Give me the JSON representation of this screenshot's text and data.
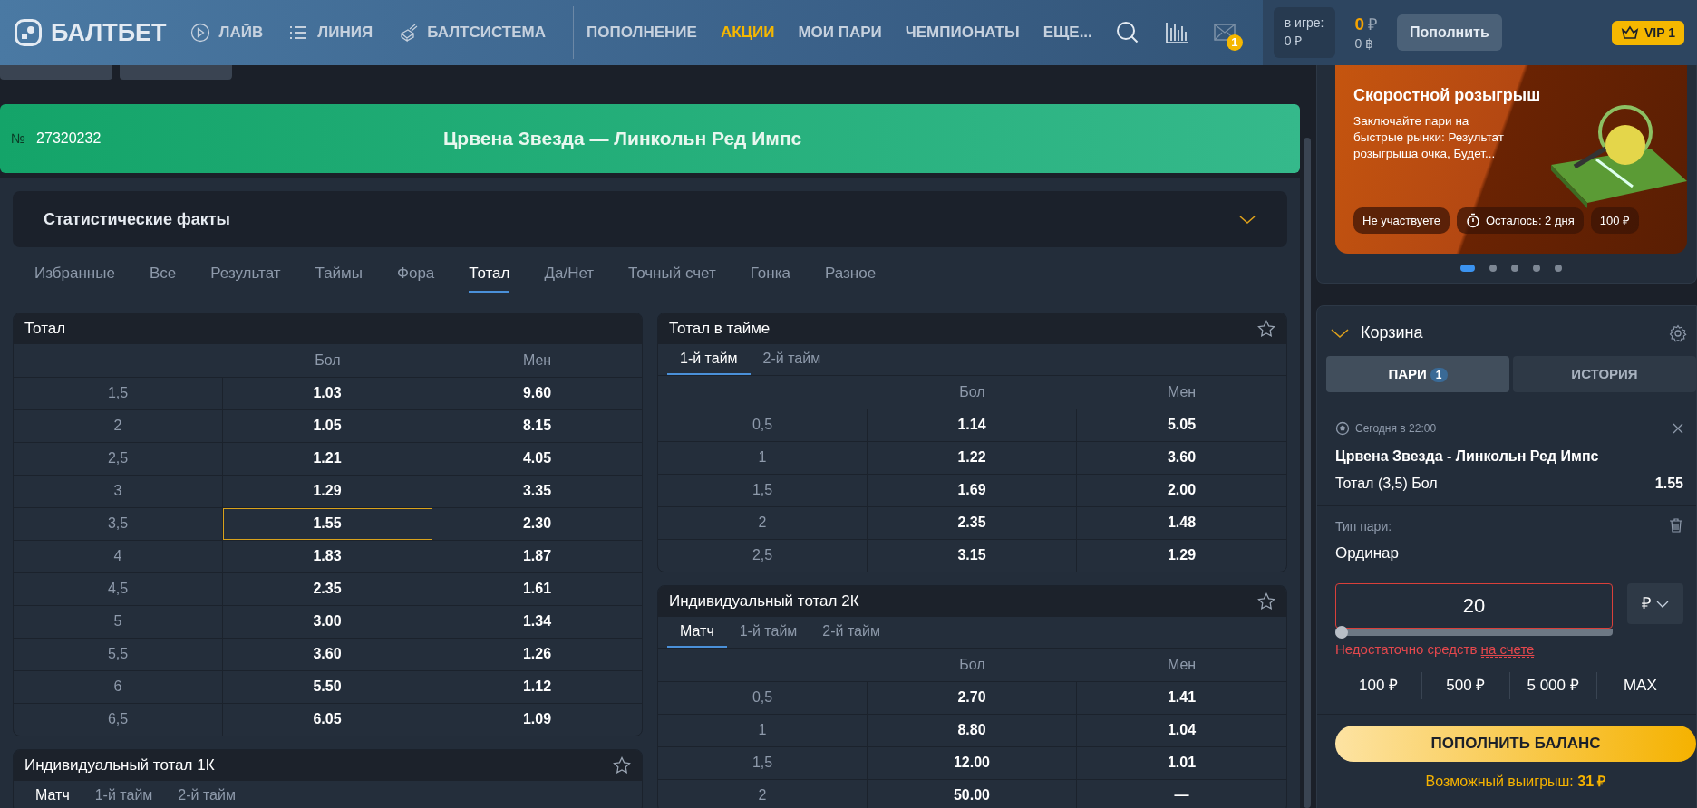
{
  "header": {
    "logo": "БАЛТБЕТ",
    "nav": [
      {
        "label": "ЛАЙВ",
        "kind": "play"
      },
      {
        "label": "ЛИНИЯ",
        "kind": "list"
      },
      {
        "label": "БАЛТСИСТЕМА",
        "kind": "dice"
      }
    ],
    "menu": [
      {
        "label": "ПОПОЛНЕНИЕ",
        "highlighted": false
      },
      {
        "label": "АКЦИИ",
        "highlighted": true
      },
      {
        "label": "МОИ ПАРИ",
        "highlighted": false
      },
      {
        "label": "ЧЕМПИОНАТЫ",
        "highlighted": false
      },
      {
        "label": "ЕЩЕ...",
        "highlighted": false
      }
    ],
    "mail_count": "1",
    "in_game_label": "в игре:",
    "in_game_value": "0 ₽",
    "balance": "0",
    "balance_currency": "₽",
    "bonus": "0 ฿",
    "deposit_button": "Пополнить",
    "vip": "VIP 1"
  },
  "event": {
    "number_sign": "№",
    "number": "27320232",
    "title": "Црвена Звезда — Линкольн Ред Импс"
  },
  "stats": {
    "title": "Статистические факты",
    "expanded": false
  },
  "market_tabs": [
    {
      "label": "Избранные",
      "selected": false
    },
    {
      "label": "Все",
      "selected": false
    },
    {
      "label": "Результат",
      "selected": false
    },
    {
      "label": "Таймы",
      "selected": false
    },
    {
      "label": "Фора",
      "selected": false
    },
    {
      "label": "Тотал",
      "selected": true
    },
    {
      "label": "Да/Нет",
      "selected": false
    },
    {
      "label": "Точный счет",
      "selected": false
    },
    {
      "label": "Гонка",
      "selected": false
    },
    {
      "label": "Разное",
      "selected": false
    }
  ],
  "market_columns": [
    [
      {
        "title": "Тотал",
        "show_star": false,
        "columns": [
          "Бол",
          "Мен"
        ],
        "rows": [
          {
            "line": "1,5",
            "over": "1.03",
            "under": "9.60",
            "over_selected": false,
            "under_selected": false
          },
          {
            "line": "2",
            "over": "1.05",
            "under": "8.15",
            "over_selected": false,
            "under_selected": false
          },
          {
            "line": "2,5",
            "over": "1.21",
            "under": "4.05",
            "over_selected": false,
            "under_selected": false
          },
          {
            "line": "3",
            "over": "1.29",
            "under": "3.35",
            "over_selected": false,
            "under_selected": false
          },
          {
            "line": "3,5",
            "over": "1.55",
            "under": "2.30",
            "over_selected": true,
            "under_selected": false
          },
          {
            "line": "4",
            "over": "1.83",
            "under": "1.87",
            "over_selected": false,
            "under_selected": false
          },
          {
            "line": "4,5",
            "over": "2.35",
            "under": "1.61",
            "over_selected": false,
            "under_selected": false
          },
          {
            "line": "5",
            "over": "3.00",
            "under": "1.34",
            "over_selected": false,
            "under_selected": false
          },
          {
            "line": "5,5",
            "over": "3.60",
            "under": "1.26",
            "over_selected": false,
            "under_selected": false
          },
          {
            "line": "6",
            "over": "5.50",
            "under": "1.12",
            "over_selected": false,
            "under_selected": false
          },
          {
            "line": "6,5",
            "over": "6.05",
            "under": "1.09",
            "over_selected": false,
            "under_selected": false
          }
        ]
      },
      {
        "title": "Индивидуальный тотал 1К",
        "show_star": true,
        "periods": [
          {
            "label": "Матч",
            "selected": true
          },
          {
            "label": "1-й тайм",
            "selected": false
          },
          {
            "label": "2-й тайм",
            "selected": false
          }
        ]
      }
    ],
    [
      {
        "title": "Тотал в тайме",
        "show_star": true,
        "periods": [
          {
            "label": "1-й тайм",
            "selected": true
          },
          {
            "label": "2-й тайм",
            "selected": false
          }
        ],
        "columns": [
          "Бол",
          "Мен"
        ],
        "rows": [
          {
            "line": "0,5",
            "over": "1.14",
            "under": "5.05",
            "over_selected": false,
            "under_selected": false
          },
          {
            "line": "1",
            "over": "1.22",
            "under": "3.60",
            "over_selected": false,
            "under_selected": false
          },
          {
            "line": "1,5",
            "over": "1.69",
            "under": "2.00",
            "over_selected": false,
            "under_selected": false
          },
          {
            "line": "2",
            "over": "2.35",
            "under": "1.48",
            "over_selected": false,
            "under_selected": false
          },
          {
            "line": "2,5",
            "over": "3.15",
            "under": "1.29",
            "over_selected": false,
            "under_selected": false
          }
        ]
      },
      {
        "title": "Индивидуальный тотал 2К",
        "show_star": true,
        "periods": [
          {
            "label": "Матч",
            "selected": true
          },
          {
            "label": "1-й тайм",
            "selected": false
          },
          {
            "label": "2-й тайм",
            "selected": false
          }
        ],
        "columns": [
          "Бол",
          "Мен"
        ],
        "rows": [
          {
            "line": "0,5",
            "over": "2.70",
            "under": "1.41",
            "over_selected": false,
            "under_selected": false
          },
          {
            "line": "1",
            "over": "8.80",
            "under": "1.04",
            "over_selected": false,
            "under_selected": false
          },
          {
            "line": "1,5",
            "over": "12.00",
            "under": "1.01",
            "over_selected": false,
            "under_selected": false
          },
          {
            "line": "2",
            "over": "50.00",
            "under": "—",
            "over_selected": false,
            "under_selected": false
          }
        ]
      }
    ]
  ],
  "promo": {
    "title": "Скоростной розыгрыш",
    "text": "Заключайте пари на быстрые рынки: Результат розыгрыша очка, Будет...",
    "chips": [
      {
        "label": "Не участвуете",
        "kind": "plain"
      },
      {
        "label": "Осталось: 2 дня",
        "kind": "timer"
      },
      {
        "label": "100 ₽",
        "kind": "plain"
      }
    ],
    "dots": [
      {
        "selected": true
      },
      {
        "selected": false
      },
      {
        "selected": false
      },
      {
        "selected": false
      },
      {
        "selected": false
      }
    ]
  },
  "betslip": {
    "title": "Корзина",
    "expanded": true,
    "tabs": [
      {
        "label": "ПАРИ",
        "count": "1",
        "selected": true
      },
      {
        "label": "ИСТОРИЯ",
        "selected": false
      }
    ],
    "bet": {
      "time": "Сегодня в 22:00",
      "match": "Црвена Звезда - Линкольн Ред Импс",
      "selection": "Тотал (3,5) Бол",
      "odds": "1.55"
    },
    "type_label": "Тип пари:",
    "type_value": "Ординар",
    "stake": "20",
    "stake_slider": {
      "level": 0
    },
    "stake_error": true,
    "currency": "₽",
    "error_text": "Недостаточно средств",
    "error_link": "на счете",
    "quick_amounts": [
      "100 ₽",
      "500 ₽",
      "5 000 ₽",
      "MAX"
    ],
    "deposit_button": "ПОПОЛНИТЬ БАЛАНС",
    "possible_win": "Возможный выигрыш: **31 ₽**"
  }
}
